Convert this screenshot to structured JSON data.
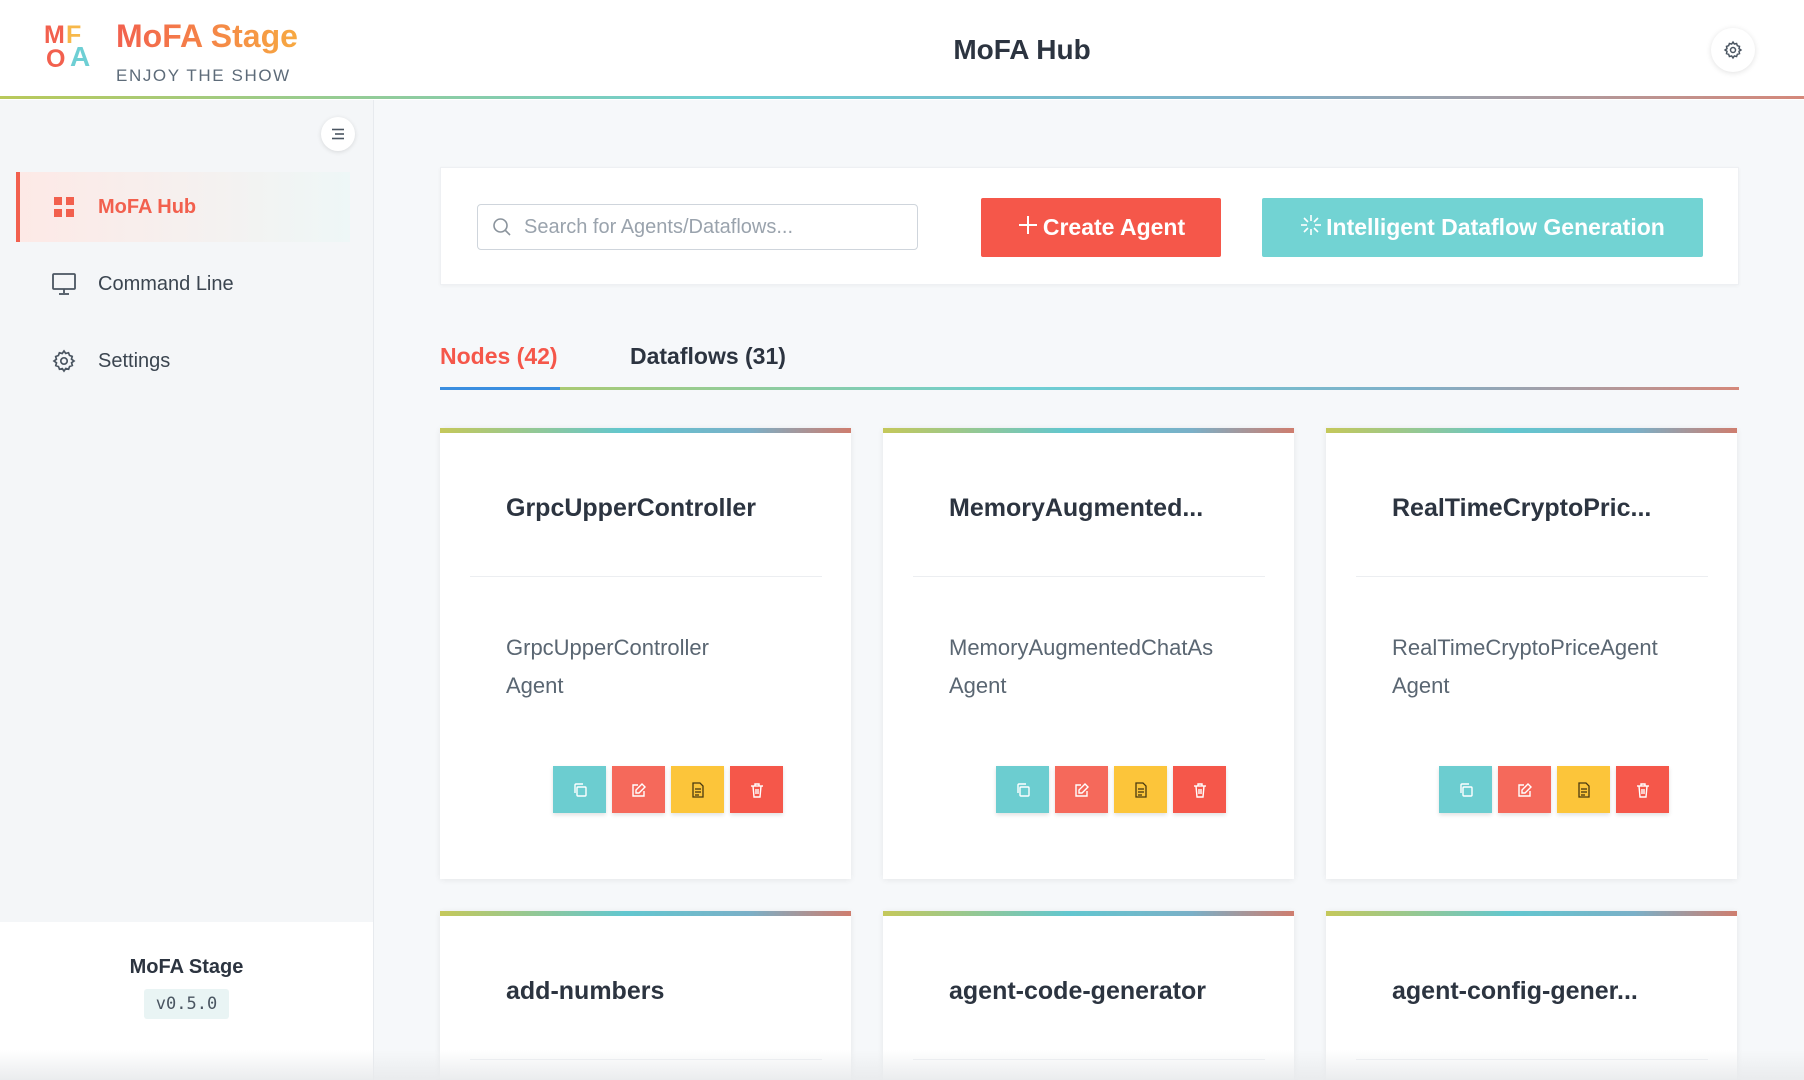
{
  "header": {
    "logo_letters": [
      "M",
      "F",
      "O",
      "A"
    ],
    "brand_title": "MoFA Stage",
    "brand_subtitle": "ENJOY THE SHOW",
    "page_title": "MoFA Hub",
    "settings_icon": "gear-icon"
  },
  "sidebar": {
    "collapse_icon": "menu-fold-icon",
    "items": [
      {
        "label": "MoFA Hub",
        "icon": "grid-icon",
        "active": true
      },
      {
        "label": "Command Line",
        "icon": "monitor-icon",
        "active": false
      },
      {
        "label": "Settings",
        "icon": "gear-icon",
        "active": false
      }
    ],
    "footer": {
      "name": "MoFA Stage",
      "version": "v0.5.0"
    }
  },
  "toolbar": {
    "search_placeholder": "Search for Agents/Dataflows...",
    "create_label": "Create Agent",
    "intelligent_label": "Intelligent Dataflow Generation"
  },
  "tabs": [
    {
      "label": "Nodes (42)",
      "active": true
    },
    {
      "label": "Dataflows (31)",
      "active": false
    }
  ],
  "cards": [
    {
      "name": "GrpcUpperController",
      "desc_line1": "GrpcUpperController",
      "desc_line2": "Agent"
    },
    {
      "name": "MemoryAugmented...",
      "desc_line1": "MemoryAugmentedChatAs",
      "desc_line2": "Agent"
    },
    {
      "name": "RealTimeCryptoPric...",
      "desc_line1": "RealTimeCryptoPriceAgent",
      "desc_line2": "Agent"
    },
    {
      "name": "add-numbers",
      "desc_line1": "",
      "desc_line2": ""
    },
    {
      "name": "agent-code-generator",
      "desc_line1": "",
      "desc_line2": ""
    },
    {
      "name": "agent-config-gener...",
      "desc_line1": "",
      "desc_line2": ""
    }
  ],
  "card_actions": [
    "copy-icon",
    "edit-icon",
    "document-icon",
    "trash-icon"
  ],
  "colors": {
    "accent_red": "#f5574a",
    "accent_teal": "#72d3d3",
    "accent_yellow": "#fcc53a",
    "active_tab_indicator": "#3a8ee0"
  }
}
